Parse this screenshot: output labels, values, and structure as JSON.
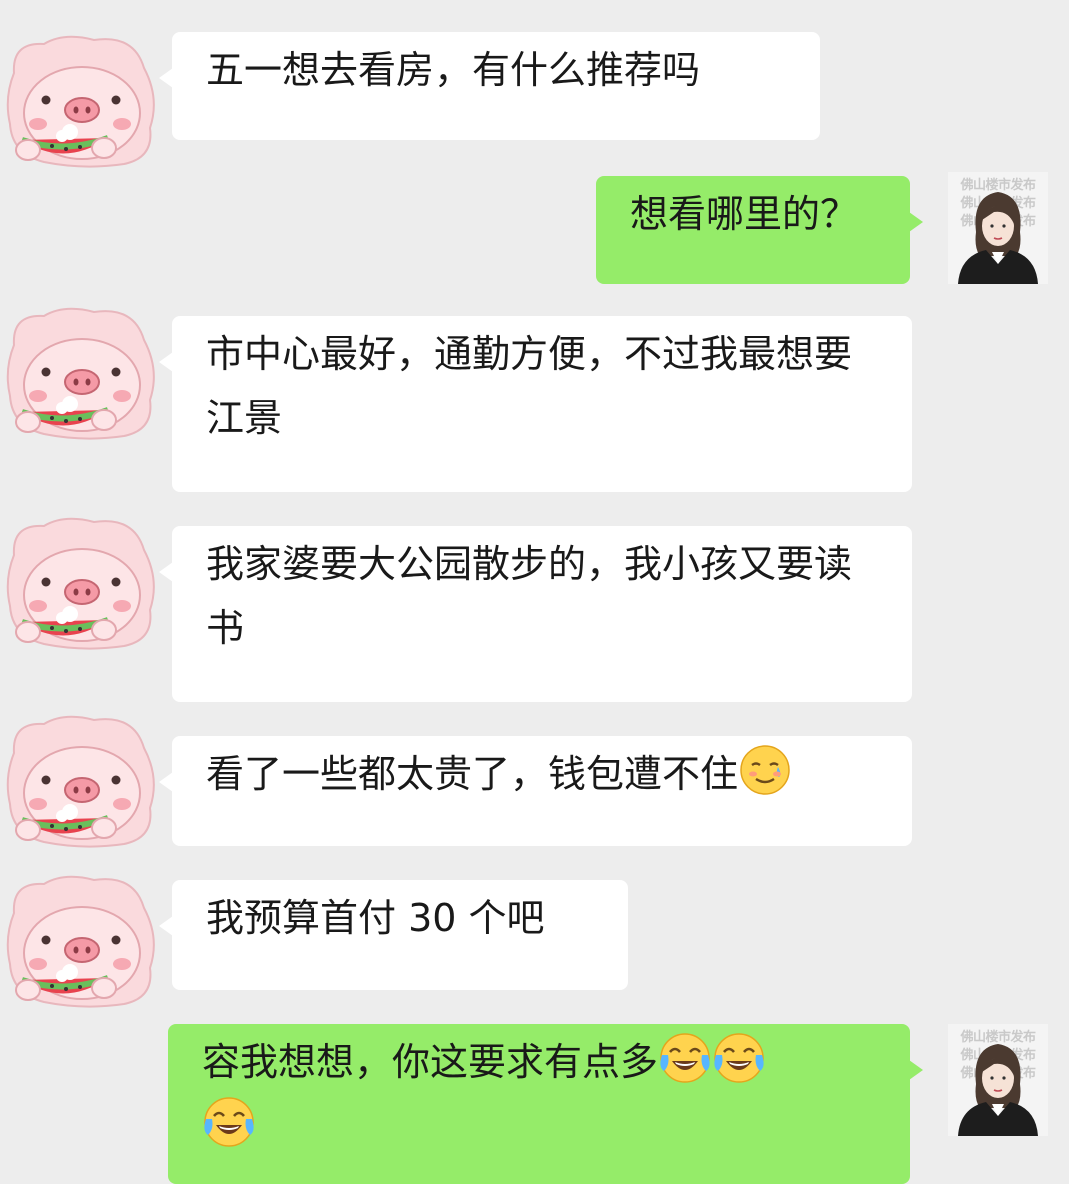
{
  "messages": [
    {
      "sender": "customer",
      "text": "五一想去看房，有什么推荐吗"
    },
    {
      "sender": "agent",
      "text": "想看哪里的？"
    },
    {
      "sender": "customer",
      "text": "市中心最好，通勤方便，不过我最想要江景"
    },
    {
      "sender": "customer",
      "text": "我家婆要大公园散步的，我小孩又要读书"
    },
    {
      "sender": "customer",
      "text": "看了一些都太贵了，钱包遭不住",
      "emojis": [
        "smiling-face-with-tear"
      ]
    },
    {
      "sender": "customer",
      "text": "我预算首付 30 个吧"
    },
    {
      "sender": "agent",
      "text": "容我想想，你这要求有点多",
      "emojis": [
        "face-with-tears-of-joy",
        "face-with-tears-of-joy",
        "face-with-tears-of-joy"
      ]
    }
  ],
  "watermark": "佛山楼市发布",
  "colors": {
    "background": "#ededed",
    "incoming_bubble": "#ffffff",
    "outgoing_bubble": "#95ec69",
    "text": "#191919",
    "pig_pink": "#f9d5d8"
  },
  "icons": {
    "customer_avatar": "pig-eating-watermelon-icon",
    "agent_avatar": "woman-in-black-suit-icon"
  }
}
